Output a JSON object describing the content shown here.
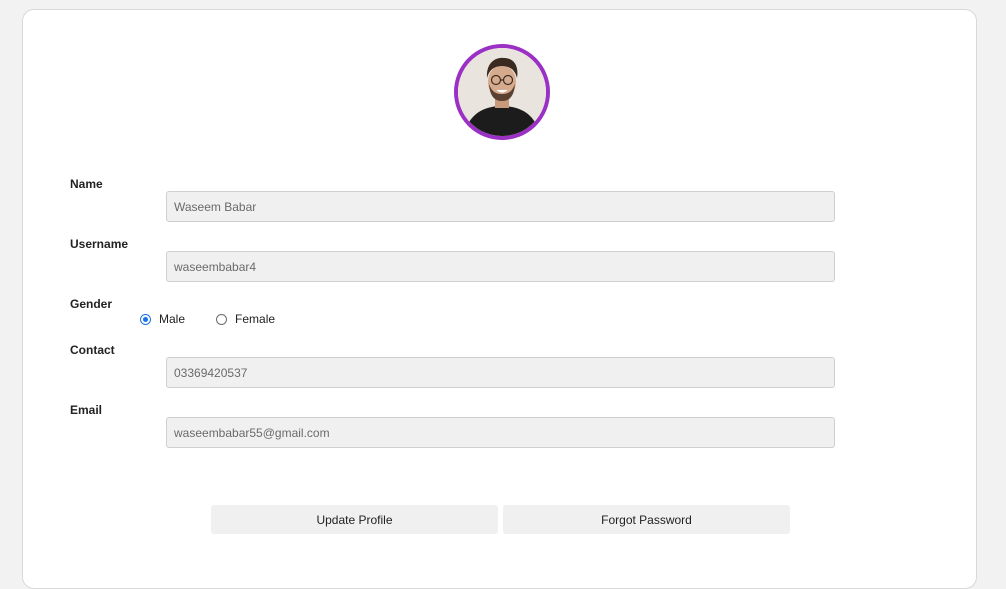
{
  "profile": {
    "avatar_icon": "user-avatar-photo",
    "avatar_ring_color": "#9b30c4"
  },
  "form": {
    "name": {
      "label": "Name",
      "value": "Waseem Babar"
    },
    "username": {
      "label": "Username",
      "value": "waseembabar4"
    },
    "gender": {
      "label": "Gender",
      "options": [
        {
          "label": "Male",
          "checked": true
        },
        {
          "label": "Female",
          "checked": false
        }
      ]
    },
    "contact": {
      "label": "Contact",
      "value": "03369420537"
    },
    "email": {
      "label": "Email",
      "value": "waseembabar55@gmail.com"
    }
  },
  "actions": {
    "update_label": "Update Profile",
    "forgot_label": "Forgot Password"
  },
  "colors": {
    "radio_accent": "#1a73e8",
    "field_bg": "#f0f0f0"
  }
}
